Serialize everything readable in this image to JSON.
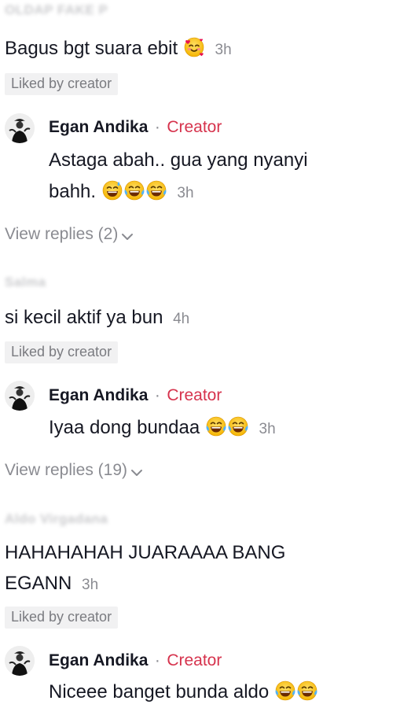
{
  "comments": [
    {
      "username": "OLDAP FAKE P",
      "text": "Bagus bgt suara ebit",
      "emoji": [
        "smiling-face-with-hearts-emoji"
      ],
      "time": "3h",
      "liked_label": "Liked by creator",
      "reply": {
        "name": "Egan Andika",
        "sep": "·",
        "badge": "Creator",
        "text_line1": "Astaga abah.. gua yang nyanyi",
        "text_line2": "bahh.",
        "emoji": [
          "grinning-sweat-emoji",
          "tears-of-joy-emoji",
          "tears-of-joy-emoji"
        ],
        "time": "3h"
      },
      "view_replies": "View replies (2)"
    },
    {
      "username": "Salma",
      "text": "si kecil aktif ya bun",
      "time": "4h",
      "liked_label": "Liked by creator",
      "reply": {
        "name": "Egan Andika",
        "sep": "·",
        "badge": "Creator",
        "text": "Iyaa dong bundaa",
        "emoji": [
          "tears-of-joy-emoji",
          "tears-of-joy-emoji"
        ],
        "time": "3h"
      },
      "view_replies": "View replies (19)"
    },
    {
      "username": "Aldo Virgadana",
      "text_line1": "HAHAHAHAH JUARAAAA BANG",
      "text_line2": "EGANN",
      "time": "3h",
      "liked_label": "Liked by creator",
      "reply": {
        "name": "Egan Andika",
        "sep": "·",
        "badge": "Creator",
        "text": "Niceee banget bunda aldo",
        "emoji": [
          "tears-of-joy-emoji",
          "tears-of-joy-emoji"
        ]
      }
    }
  ],
  "colors": {
    "creator": "#d6334d",
    "muted": "#8a8b91",
    "liked_bg": "#f1f1f2",
    "text": "#161823"
  }
}
